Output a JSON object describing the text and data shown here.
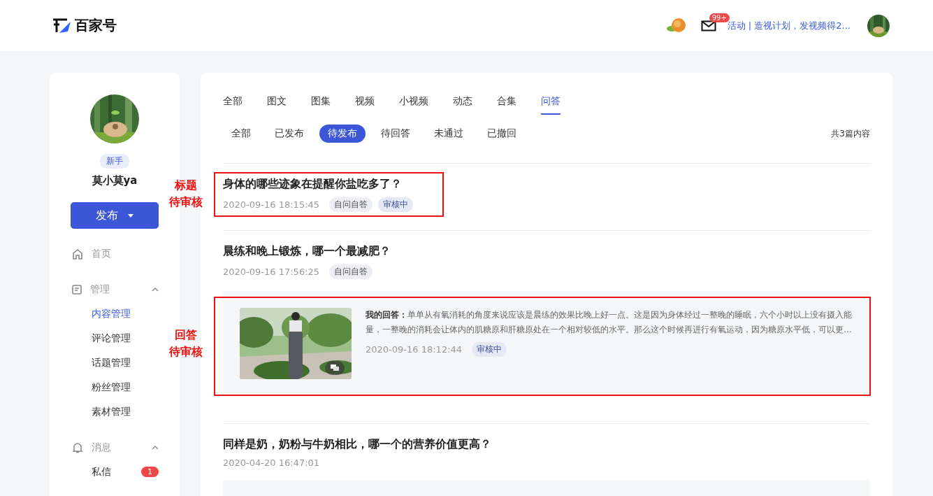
{
  "header": {
    "logo": "百家号",
    "mail_badge": "99+",
    "promo": "活动 | 造视计划，发视频得2..."
  },
  "profile": {
    "level": "新手",
    "name": "莫小莫ya",
    "publish": "发布"
  },
  "nav": [
    {
      "label": "首页",
      "kind": "link"
    },
    {
      "label": "管理",
      "kind": "group",
      "expanded": true,
      "children": [
        {
          "label": "内容管理",
          "selected": true
        },
        {
          "label": "评论管理",
          "selected": false
        },
        {
          "label": "话题管理",
          "selected": false
        },
        {
          "label": "粉丝管理",
          "selected": false
        },
        {
          "label": "素材管理",
          "selected": false
        }
      ]
    },
    {
      "label": "消息",
      "kind": "group",
      "expanded": true,
      "children": [
        {
          "label": "私信",
          "selected": false,
          "badge": "1"
        }
      ]
    }
  ],
  "type_tabs": [
    {
      "label": "全部",
      "selected": false
    },
    {
      "label": "图文",
      "selected": false
    },
    {
      "label": "图集",
      "selected": false
    },
    {
      "label": "视频",
      "selected": false
    },
    {
      "label": "小视频",
      "selected": false
    },
    {
      "label": "动态",
      "selected": false
    },
    {
      "label": "合集",
      "selected": false
    },
    {
      "label": "问答",
      "selected": true
    }
  ],
  "status_tabs": [
    {
      "label": "全部",
      "selected": false
    },
    {
      "label": "已发布",
      "selected": false
    },
    {
      "label": "待发布",
      "selected": true
    },
    {
      "label": "待回答",
      "selected": false
    },
    {
      "label": "未通过",
      "selected": false
    },
    {
      "label": "已撤回",
      "selected": false
    }
  ],
  "total": "共3篇内容",
  "items": [
    {
      "title": "身体的哪些迹象在提醒你盐吃多了？",
      "time": "2020-09-16 18:15:45",
      "tags": [
        {
          "text": "自问自答",
          "kind": "type"
        },
        {
          "text": "审核中",
          "kind": "status"
        }
      ]
    },
    {
      "title": "晨练和晚上锻炼，哪一个最减肥？",
      "time": "2020-09-16 17:56:25",
      "tags": [
        {
          "text": "自问自答",
          "kind": "type"
        }
      ],
      "answer": {
        "label": "我的回答：",
        "text": "单单从有氧消耗的角度来说应该是晨练的效果比晚上好一点。这是因为身体经过一整晚的睡眠，六个小时以上没有摄入能量，一整晚的消耗会让体内的肌糖原和肝糖原处在一个相对较低的水平。那么这个时候再进行有氧运动，因为糖原水平低，可以更…",
        "time": "2020-09-16 18:12:44",
        "tags": [
          {
            "text": "审核中",
            "kind": "status"
          }
        ]
      }
    },
    {
      "title": "同样是奶，奶粉与牛奶相比，哪一个的营养价值更高？",
      "time": "2020-04-20 16:47:01",
      "answer_panel": true
    }
  ],
  "annotations": [
    {
      "lines": [
        "标题",
        "待审核"
      ]
    },
    {
      "lines": [
        "回答",
        "待审核"
      ]
    }
  ]
}
